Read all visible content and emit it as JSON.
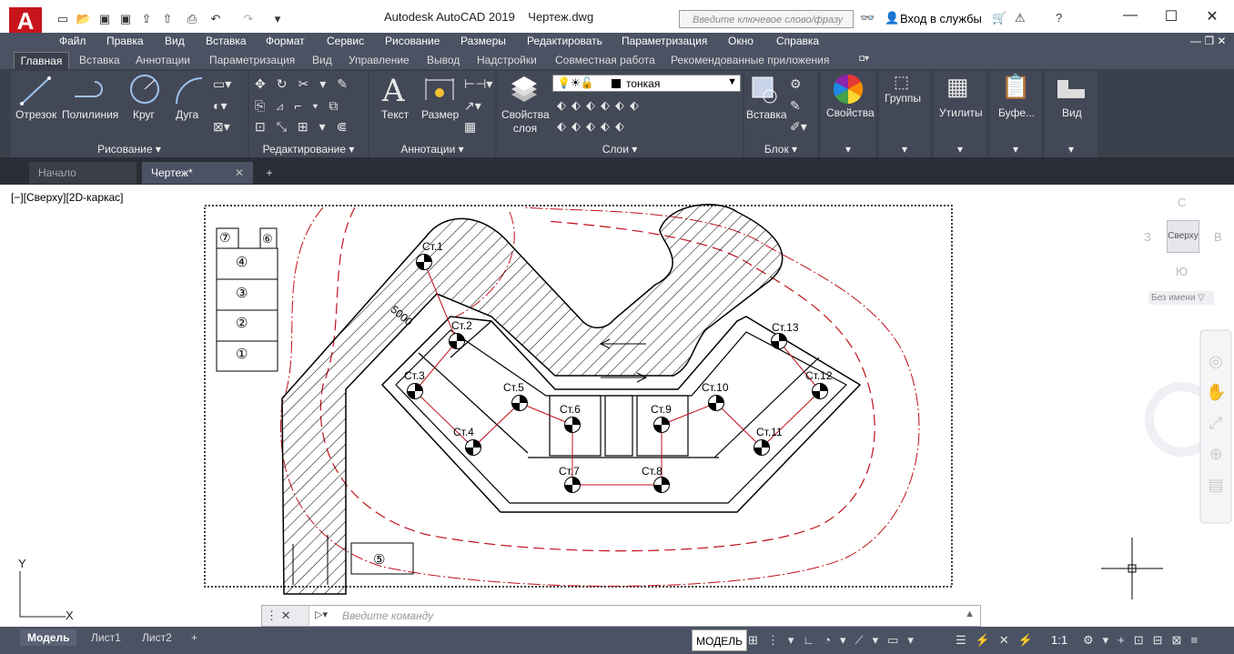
{
  "titlebar": {
    "app_title": "Autodesk AutoCAD 2019",
    "file_name": "Чертеж.dwg",
    "search_placeholder": "Введите ключевое слово/фразу",
    "login_label": "Вход в службы",
    "app_logo": "A"
  },
  "menu": [
    "Файл",
    "Правка",
    "Вид",
    "Вставка",
    "Формат",
    "Сервис",
    "Рисование",
    "Размеры",
    "Редактировать",
    "Параметризация",
    "Окно",
    "Справка"
  ],
  "ribbon_tabs": [
    "Главная",
    "Вставка",
    "Аннотации",
    "Параметризация",
    "Вид",
    "Управление",
    "Вывод",
    "Надстройки",
    "Совместная работа",
    "Рекомендованные приложения"
  ],
  "ribbon": {
    "draw": {
      "line": "Отрезок",
      "polyline": "Полилиния",
      "circle": "Круг",
      "arc": "Дуга",
      "panel": "Рисование"
    },
    "modify": {
      "panel": "Редактирование"
    },
    "annotation": {
      "text": "Текст",
      "dimension": "Размер",
      "panel": "Аннотации"
    },
    "layers": {
      "layer_props": "Свойства слоя",
      "layer_props_2": "слоя",
      "layer_props_1": "Свойства",
      "current_layer": "тонкая",
      "panel": "Слои"
    },
    "block": {
      "insert": "Вставка",
      "panel": "Блок"
    },
    "properties": "Свойства",
    "groups": "Группы",
    "utilities": "Утилиты",
    "clipboard": "Буфе...",
    "view": "Вид"
  },
  "file_tabs": [
    "Начало",
    "Чертеж*"
  ],
  "viewport_label": "[−][Сверху][2D-каркас]",
  "viewcube": {
    "top": "Сверху",
    "north": "С",
    "south": "Ю",
    "west": "З",
    "east": "В",
    "ucs": "Без имени"
  },
  "drawing": {
    "stations": [
      "Ст.1",
      "Ст.2",
      "Ст.3",
      "Ст.4",
      "Ст.5",
      "Ст.6",
      "Ст.7",
      "Ст.8",
      "Ст.9",
      "Ст.10",
      "Ст.11",
      "Ст.12",
      "Ст.13"
    ],
    "legend": [
      "⑦",
      "⑥",
      "④",
      "③",
      "②",
      "①",
      "⑤"
    ],
    "dimension": "5000"
  },
  "cmd_placeholder": "Введите команду",
  "layout_tabs": [
    "Модель",
    "Лист1",
    "Лист2"
  ],
  "status": {
    "model": "МОДЕЛЬ",
    "scale": "1:1"
  },
  "colors": {
    "accent": "#c8141c",
    "ribbon_bg": "#434857",
    "menubar": "#4b5263",
    "contour_red": "#c0101a"
  }
}
